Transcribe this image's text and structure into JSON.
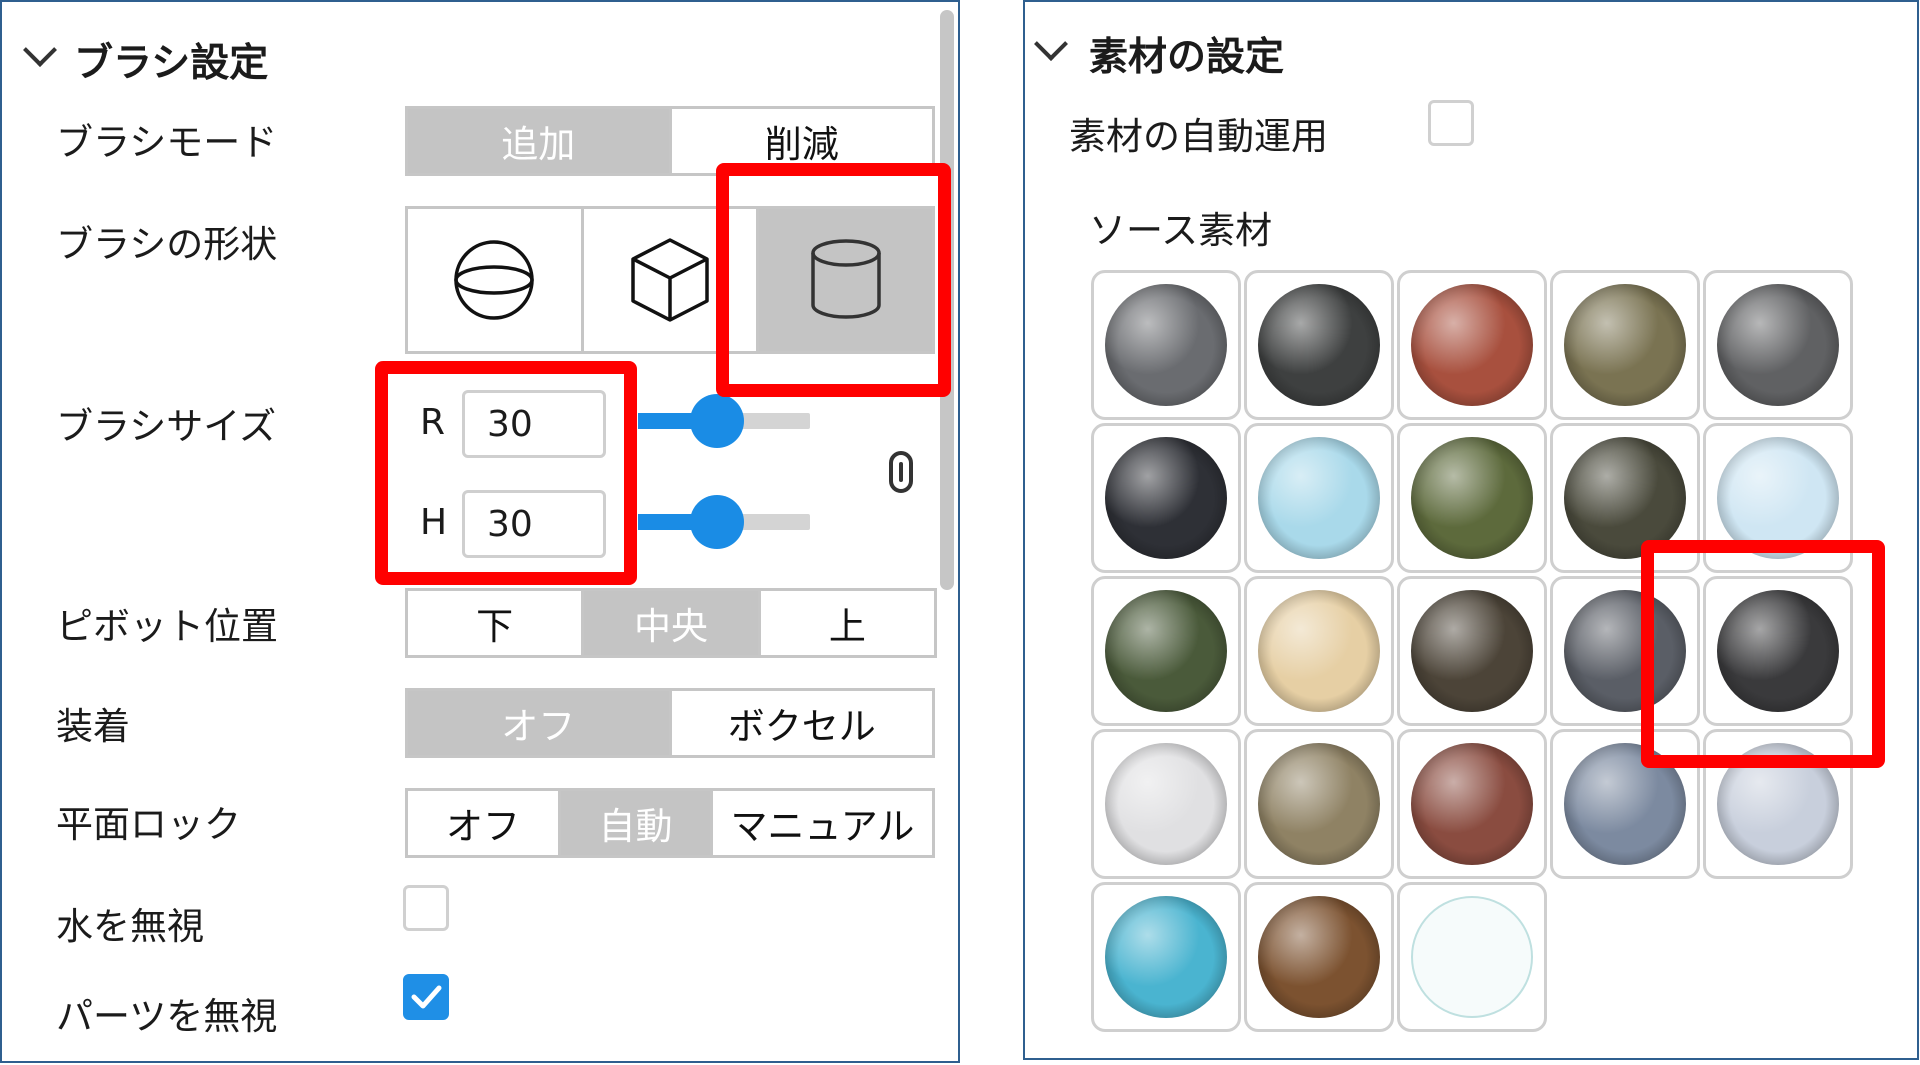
{
  "brush_panel": {
    "section_title": "ブラシ設定",
    "brush_mode": {
      "label": "ブラシモード",
      "options": [
        "追加",
        "削減"
      ],
      "selected": "追加"
    },
    "brush_shape": {
      "label": "ブラシの形状",
      "options": [
        "sphere-icon",
        "cube-icon",
        "cylinder-icon"
      ],
      "selected": "cylinder-icon"
    },
    "brush_size": {
      "label": "ブラシサイズ",
      "r_label": "R",
      "r_value": "30",
      "r_slider_fraction": 0.46,
      "h_label": "H",
      "h_value": "30",
      "h_slider_fraction": 0.46,
      "link_icon": "link-icon"
    },
    "pivot": {
      "label": "ピボット位置",
      "options": [
        "下",
        "中央",
        "上"
      ],
      "selected": "中央"
    },
    "attach": {
      "label": "装着",
      "options": [
        "オフ",
        "ボクセル"
      ],
      "selected": "オフ"
    },
    "plane_lock": {
      "label": "平面ロック",
      "options": [
        "オフ",
        "自動",
        "マニュアル"
      ],
      "selected": "自動"
    },
    "ignore_water": {
      "label": "水を無視",
      "checked": false
    },
    "ignore_parts": {
      "label": "パーツを無視",
      "checked": true
    }
  },
  "material_panel": {
    "section_title": "素材の設定",
    "auto_apply": {
      "label": "素材の自動運用",
      "checked": false
    },
    "source_label": "ソース素材",
    "selected_material_index": 14,
    "materials": [
      {
        "name": "asphalt",
        "color": "#6a6c70"
      },
      {
        "name": "basalt",
        "color": "#3e4040"
      },
      {
        "name": "brick",
        "color": "#a8503e"
      },
      {
        "name": "cobblestone",
        "color": "#7a7352"
      },
      {
        "name": "concrete",
        "color": "#606163"
      },
      {
        "name": "cracked-lava",
        "color": "#2e3036"
      },
      {
        "name": "glacier",
        "color": "#a9d9ea"
      },
      {
        "name": "grass",
        "color": "#5d6a3c"
      },
      {
        "name": "ground",
        "color": "#4a4a3c"
      },
      {
        "name": "ice",
        "color": "#cfe6f3"
      },
      {
        "name": "leafy-grass",
        "color": "#4a5a3a"
      },
      {
        "name": "limestone",
        "color": "#e6cfa4"
      },
      {
        "name": "mud",
        "color": "#4c4438"
      },
      {
        "name": "pavement",
        "color": "#5a5e66"
      },
      {
        "name": "rock",
        "color": "#3a3a3c"
      },
      {
        "name": "salt",
        "color": "#e0e0e2"
      },
      {
        "name": "sand",
        "color": "#8f8264"
      },
      {
        "name": "sandstone",
        "color": "#8a4c40"
      },
      {
        "name": "slate",
        "color": "#7c8aa0"
      },
      {
        "name": "snow",
        "color": "#c8cfdc"
      },
      {
        "name": "water",
        "color": "#4ab4d0"
      },
      {
        "name": "wood-planks",
        "color": "#7c5230"
      },
      {
        "name": "air",
        "color": "#f6fbfb"
      }
    ]
  },
  "colors": {
    "accent": "#1a8ce5",
    "highlight": "#ff0000",
    "panel_border": "#2f5f8f",
    "segment_active": "#c4c4c4"
  }
}
